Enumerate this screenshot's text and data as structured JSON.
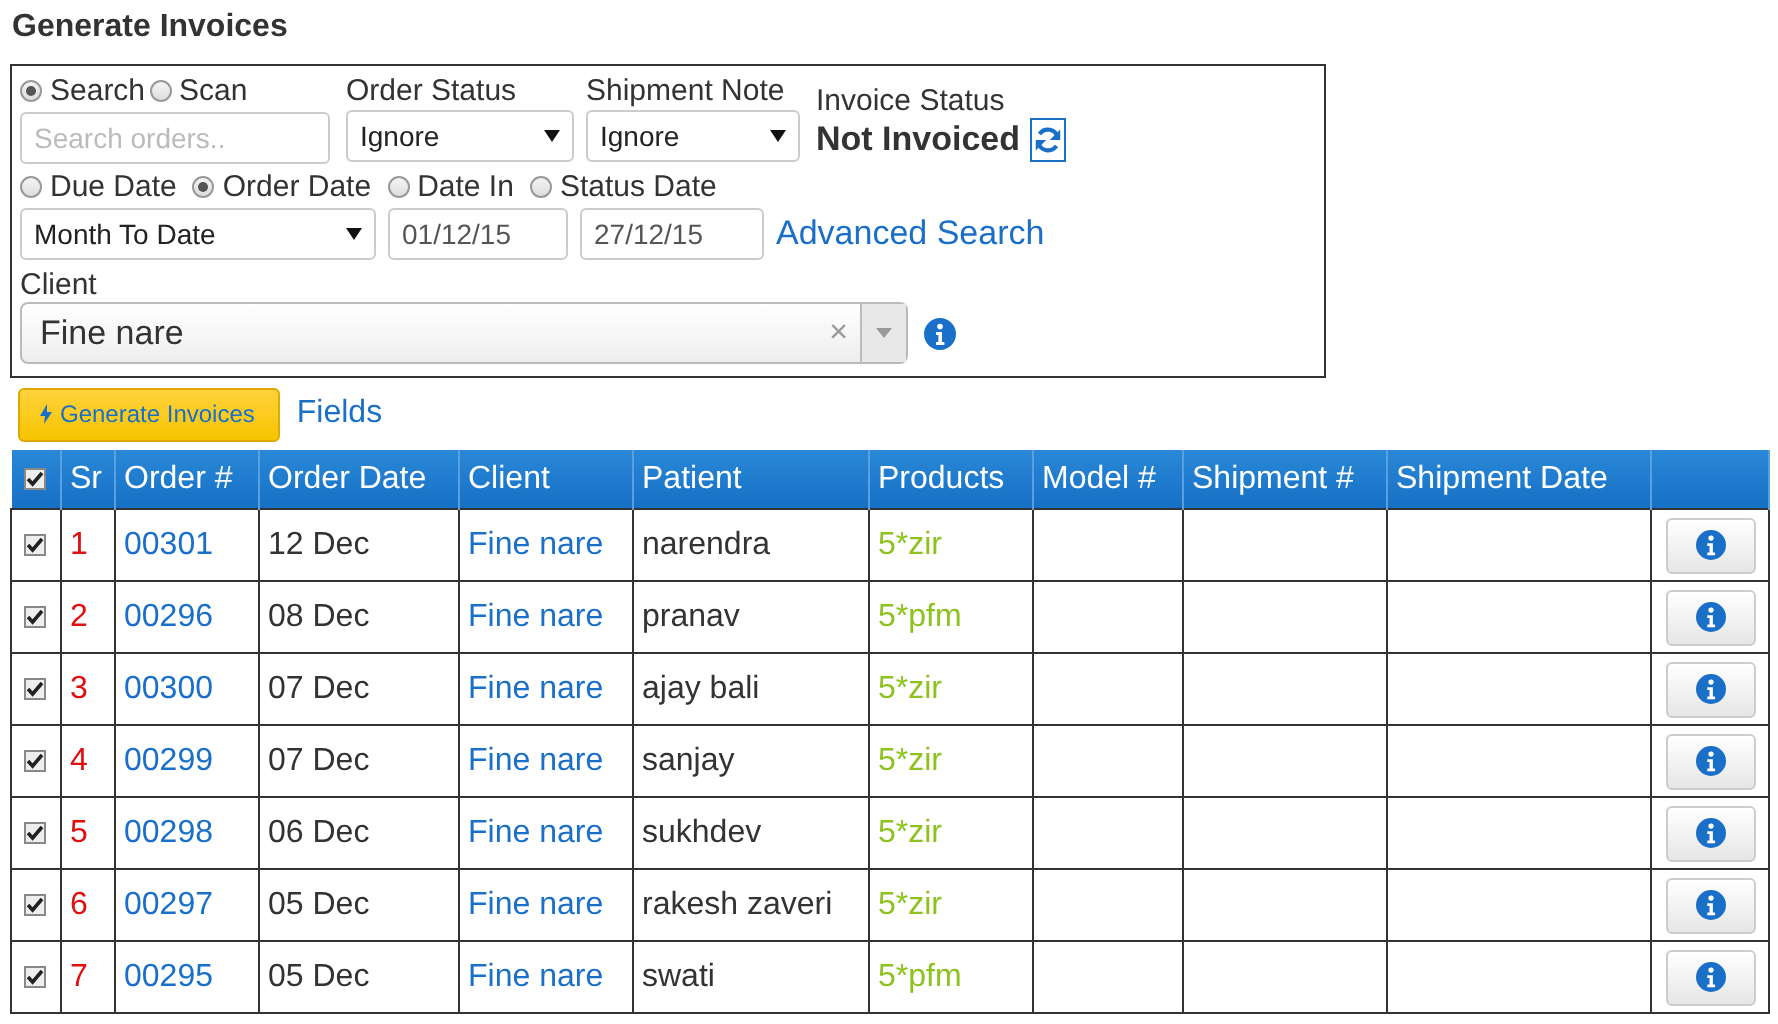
{
  "title": "Generate Invoices",
  "filters": {
    "search_modes": [
      {
        "label": "Search",
        "selected": true
      },
      {
        "label": "Scan",
        "selected": false
      }
    ],
    "search": {
      "placeholder": "Search orders.."
    },
    "order_status": {
      "label": "Order Status",
      "value": "Ignore"
    },
    "shipment_note": {
      "label": "Shipment Note",
      "value": "Ignore"
    },
    "invoice_status": {
      "label": "Invoice Status",
      "value": "Not Invoiced"
    },
    "date_types": [
      {
        "label": "Due Date",
        "selected": false
      },
      {
        "label": "Order Date",
        "selected": true
      },
      {
        "label": "Date In",
        "selected": false
      },
      {
        "label": "Status Date",
        "selected": false
      }
    ],
    "date_range": "Month To Date",
    "date_from": "01/12/15",
    "date_to": "27/12/15",
    "advanced_search": "Advanced Search",
    "client": {
      "label": "Client",
      "value": "Fine nare",
      "clear": "×"
    }
  },
  "actions": {
    "generate": "Generate Invoices",
    "fields": "Fields"
  },
  "table": {
    "select_all": true,
    "columns": [
      "Sr",
      "Order #",
      "Order Date",
      "Client",
      "Patient",
      "Products",
      "Model #",
      "Shipment #",
      "Shipment Date"
    ],
    "rows": [
      {
        "checked": true,
        "sr": "1",
        "order": "00301",
        "date": "12 Dec",
        "client": "Fine nare",
        "patient": "narendra",
        "products": "5*zir"
      },
      {
        "checked": true,
        "sr": "2",
        "order": "00296",
        "date": "08 Dec",
        "client": "Fine nare",
        "patient": "pranav",
        "products": "5*pfm"
      },
      {
        "checked": true,
        "sr": "3",
        "order": "00300",
        "date": "07 Dec",
        "client": "Fine nare",
        "patient": "ajay bali",
        "products": "5*zir"
      },
      {
        "checked": true,
        "sr": "4",
        "order": "00299",
        "date": "07 Dec",
        "client": "Fine nare",
        "patient": "sanjay",
        "products": "5*zir"
      },
      {
        "checked": true,
        "sr": "5",
        "order": "00298",
        "date": "06 Dec",
        "client": "Fine nare",
        "patient": "sukhdev",
        "products": "5*zir"
      },
      {
        "checked": true,
        "sr": "6",
        "order": "00297",
        "date": "05 Dec",
        "client": "Fine nare",
        "patient": "rakesh zaveri",
        "products": "5*zir"
      },
      {
        "checked": true,
        "sr": "7",
        "order": "00295",
        "date": "05 Dec",
        "client": "Fine nare",
        "patient": "swati",
        "products": "5*pfm"
      }
    ]
  }
}
